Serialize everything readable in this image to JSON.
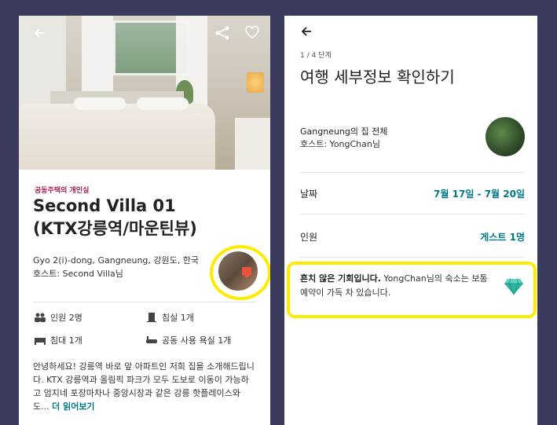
{
  "left": {
    "listing_type": "공동주택의 개인실",
    "title_line1": "Second Villa 01",
    "title_line2": "(KTX강릉역/마운틴뷰)",
    "location": "Gyo 2(i)-dong, Gangneung, 강원도, 한국",
    "host": "호스트: Second Villa님",
    "amenities": {
      "guests": "인원 2명",
      "bedrooms": "침실 1개",
      "beds": "침대 1개",
      "bath": "공동 사용 욕실 1개"
    },
    "description": "안녕하세요! 강릉역 바로 앞 아파트인 저희 집을 소개해드립니다. KTX 강릉역과 올림픽 파크가 모두 도보로 이동이 가능하고 엄지네 포장마차나 중앙시장과 같은 강릉 핫플레이스와도...",
    "read_more": "더 읽어보기"
  },
  "right": {
    "step": "1 / 4 단계",
    "title": "여행 세부정보 확인하기",
    "home_name": "Gangneung의 집 전체",
    "home_host": "호스트: YongChan님",
    "dates_label": "날짜",
    "dates_value": "7월 17일 - 7월 20일",
    "guests_label": "인원",
    "guests_value": "게스트 1명",
    "rare_bold": "흔치 않은 기회입니다.",
    "rare_rest": " YongChan님의 숙소는 보통 예약이 가득 차 있습니다."
  },
  "colors": {
    "accent": "#007a87",
    "highlight": "#ffeb00",
    "type_label": "#a61d55"
  }
}
